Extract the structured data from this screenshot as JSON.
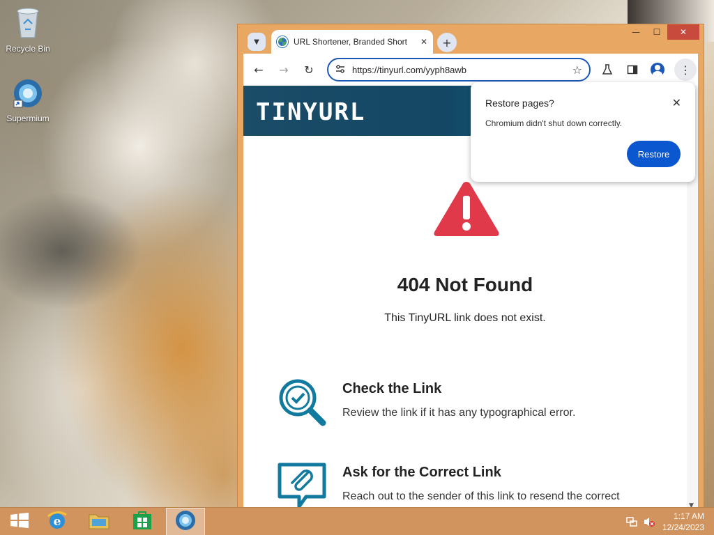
{
  "desktop": {
    "icons": [
      {
        "label": "Recycle Bin",
        "icon": "recycle-bin-icon"
      },
      {
        "label": "Supermium",
        "icon": "supermium-icon"
      }
    ]
  },
  "browser": {
    "tab": {
      "title": "URL Shortener, Branded Short",
      "close": "✕"
    },
    "newtab": "+",
    "nav": {
      "back": "←",
      "forward": "→",
      "reload": "↻"
    },
    "omnibox": {
      "url": "https://tinyurl.com/yyph8awb"
    },
    "window_controls": {
      "minimize": "—",
      "maximize": "☐",
      "close": "✕"
    }
  },
  "page": {
    "logo": "TINYURL",
    "heading": "404 Not Found",
    "subheading": "This TinyURL link does not exist.",
    "tips": [
      {
        "title": "Check the Link",
        "description": "Review the link if it has any typographical error.",
        "icon": "magnifier-check-icon"
      },
      {
        "title": "Ask for the Correct Link",
        "description": "Reach out to the sender of this link to resend the correct one.",
        "icon": "chat-paperclip-icon"
      }
    ]
  },
  "popup": {
    "title": "Restore pages?",
    "message": "Chromium didn't shut down correctly.",
    "button": "Restore",
    "close": "✕"
  },
  "taskbar": {
    "time": "1:17 AM",
    "date": "12/24/2023"
  },
  "colors": {
    "accent_blue": "#0b57d0",
    "window_frame": "#e9a764",
    "alert_red": "#e03a4a",
    "teal_icon": "#117a9e"
  }
}
